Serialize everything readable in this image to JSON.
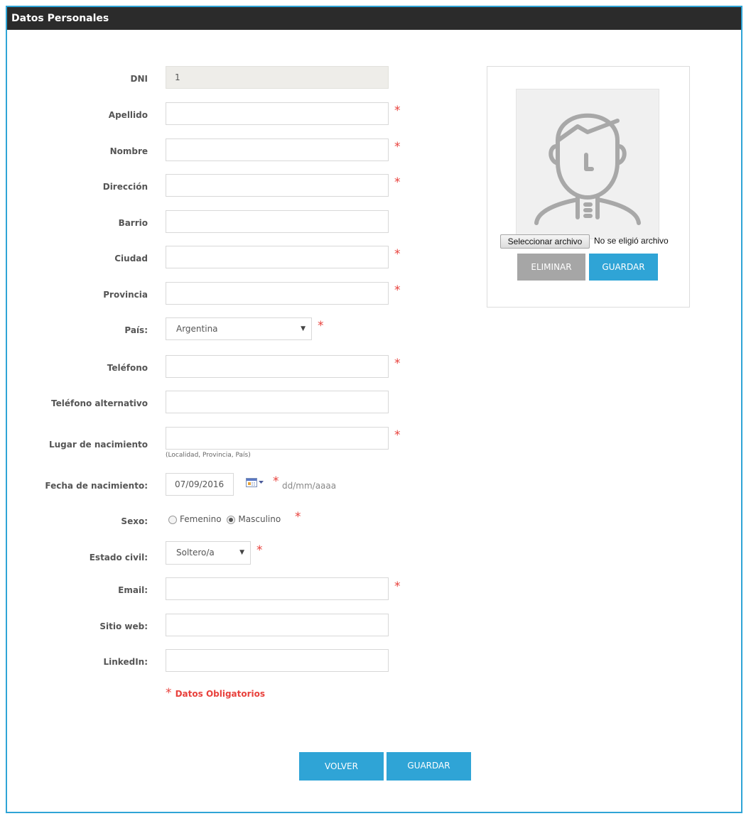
{
  "header": {
    "title": "Datos Personales"
  },
  "form": {
    "dni": {
      "label": "DNI",
      "value": "1"
    },
    "apellido": {
      "label": "Apellido",
      "value": ""
    },
    "nombre": {
      "label": "Nombre",
      "value": ""
    },
    "direccion": {
      "label": "Dirección",
      "value": ""
    },
    "barrio": {
      "label": "Barrio",
      "value": ""
    },
    "ciudad": {
      "label": "Ciudad",
      "value": ""
    },
    "provincia": {
      "label": "Provincia",
      "value": ""
    },
    "pais": {
      "label": "País:",
      "value": "Argentina"
    },
    "telefono": {
      "label": "Teléfono",
      "value": ""
    },
    "telefono_alt": {
      "label": "Teléfono alternativo",
      "value": ""
    },
    "lugar_nac": {
      "label": "Lugar de nacimiento",
      "value": "",
      "hint": "(Localidad, Provincia, País)"
    },
    "fecha_nac": {
      "label": "Fecha de nacimiento:",
      "value": "07/09/2016",
      "format_hint": "dd/mm/aaaa"
    },
    "sexo": {
      "label": "Sexo:",
      "options": [
        "Femenino",
        "Masculino"
      ],
      "selected": "Masculino"
    },
    "estado_civil": {
      "label": "Estado civil:",
      "value": "Soltero/a"
    },
    "email": {
      "label": "Email:",
      "value": ""
    },
    "sitio_web": {
      "label": "Sitio web:",
      "value": ""
    },
    "linkedin": {
      "label": "LinkedIn:",
      "value": ""
    },
    "required_mark": "*",
    "required_note": "Datos Obligatorios"
  },
  "photo": {
    "file_button": "Seleccionar archivo",
    "file_status": "No se eligió archivo",
    "delete_label": "ELIMINAR",
    "save_label": "GUARDAR"
  },
  "actions": {
    "back_label": "VOLVER",
    "save_label": "GUARDAR"
  },
  "colors": {
    "accent": "#2fa4d6",
    "required": "#e8413c",
    "header_bg": "#2b2b2b",
    "disabled_button": "#a6a6a6"
  }
}
